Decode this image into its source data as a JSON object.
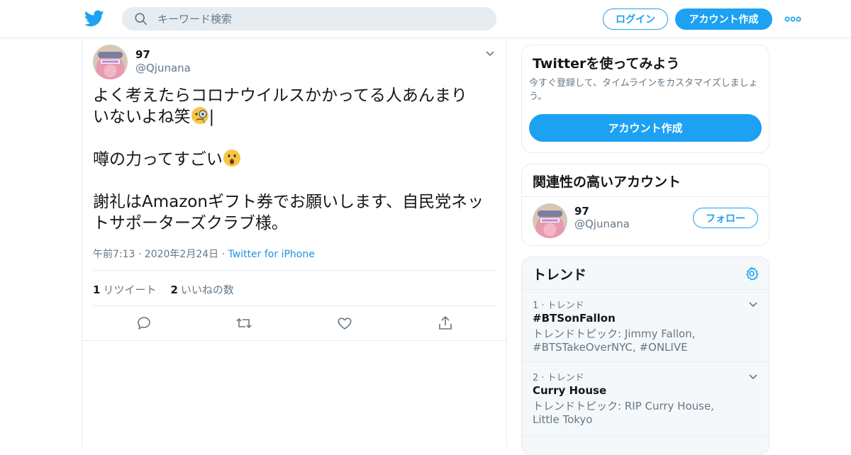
{
  "header": {
    "search_placeholder": "キーワード検索",
    "login_label": "ログイン",
    "signup_label": "アカウント作成",
    "brand_color": "#1da1f2"
  },
  "tweet": {
    "author_name": "97",
    "author_handle": "@Qjunana",
    "text_line1": "よく考えたらコロナウイルスかかってる人あんまり",
    "text_line2": "いないよね笑",
    "text_line2_end": "|",
    "text_line3": "噂の力ってすごい",
    "text_line4": "謝礼はAmazonギフト券でお願いします、自民党ネッ",
    "text_line5": "トサポーターズクラブ様。",
    "emoji1": "monocle-face",
    "emoji2": "face-with-open-mouth",
    "timestamp": "午前7:13 · 2020年2月24日",
    "meta_sep": " · ",
    "via": "Twitter for iPhone",
    "retweet_count": "1",
    "retweet_label": "リツイート",
    "like_count": "2",
    "like_label": "いいねの数"
  },
  "sidebar": {
    "signup_card": {
      "title": "Twitterを使ってみよう",
      "description": "今すぐ登録して、タイムラインをカスタマイズしましょう。",
      "button_label": "アカウント作成"
    },
    "related_card": {
      "title": "関連性の高いアカウント",
      "account_name": "97",
      "account_handle": "@Qjunana",
      "follow_label": "フォロー"
    },
    "trends_card": {
      "title": "トレンド",
      "items": [
        {
          "rank": "1 · トレンド",
          "name": "#BTSonFallon",
          "topic": "トレンドトピック: Jimmy Fallon, #BTSTakeOverNYC, #ONLIVE"
        },
        {
          "rank": "2 · トレンド",
          "name": "Curry House",
          "topic": "トレンドトピック: RIP Curry House, Little Tokyo"
        }
      ]
    }
  }
}
